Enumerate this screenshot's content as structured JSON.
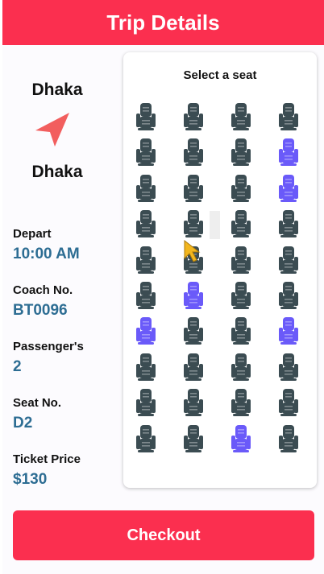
{
  "header": {
    "title": "Trip Details"
  },
  "trip": {
    "from": "Dhaka",
    "to": "Dhaka",
    "depart_label": "Depart",
    "depart_value": "10:00 AM",
    "coach_label": "Coach No.",
    "coach_value": "BT0096",
    "passengers_label": "Passenger's",
    "passengers_value": "2",
    "seat_label": "Seat No.",
    "seat_value": "D2",
    "price_label": "Ticket Price",
    "price_value": "$130"
  },
  "seat_map": {
    "title": "Select a seat",
    "columns": 4,
    "rows": [
      [
        "available",
        "available",
        "available",
        "available"
      ],
      [
        "available",
        "available",
        "available",
        "booked"
      ],
      [
        "available",
        "available",
        "available",
        "booked"
      ],
      [
        "available",
        "available",
        "available",
        "available"
      ],
      [
        "available",
        "available",
        "available",
        "available"
      ],
      [
        "available",
        "booked",
        "available",
        "available"
      ],
      [
        "booked",
        "available",
        "available",
        "booked"
      ],
      [
        "available",
        "available",
        "available",
        "available"
      ],
      [
        "available",
        "available",
        "available",
        "available"
      ],
      [
        "available",
        "available",
        "booked",
        "available"
      ]
    ]
  },
  "colors": {
    "accent": "#fb2f4f",
    "value_text": "#2d6d93",
    "seat_available": "#3b4c52",
    "seat_booked": "#6a5af9",
    "nav_icon": "#f25e5e"
  },
  "icons": {
    "direction": "navigation-arrow-icon",
    "seat": "seat-icon"
  },
  "checkout": {
    "label": "Checkout"
  }
}
